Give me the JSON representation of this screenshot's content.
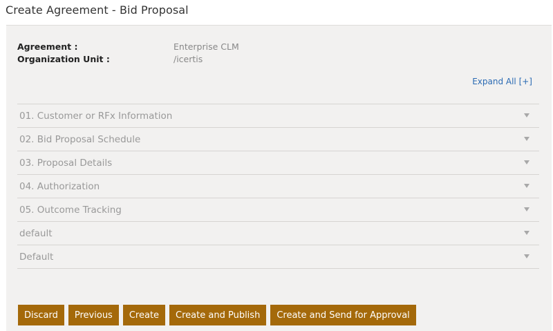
{
  "page": {
    "title": "Create Agreement - Bid Proposal"
  },
  "meta": {
    "agreement_label": "Agreement :",
    "agreement_value": "Enterprise CLM",
    "org_unit_label": "Organization Unit :",
    "org_unit_value": "/icertis"
  },
  "expand_all": "Expand All [+]",
  "sections": [
    {
      "label": "01. Customer or RFx Information"
    },
    {
      "label": "02. Bid Proposal Schedule"
    },
    {
      "label": "03. Proposal Details"
    },
    {
      "label": "04. Authorization"
    },
    {
      "label": "05. Outcome Tracking"
    },
    {
      "label": "default"
    },
    {
      "label": "Default"
    }
  ],
  "actions": {
    "discard": "Discard",
    "previous": "Previous",
    "create": "Create",
    "create_publish": "Create and Publish",
    "create_send_approval": "Create and Send for Approval"
  },
  "colors": {
    "button_bg": "#a4690a",
    "panel_bg": "#f2f1f0",
    "link": "#2a6ab3"
  }
}
